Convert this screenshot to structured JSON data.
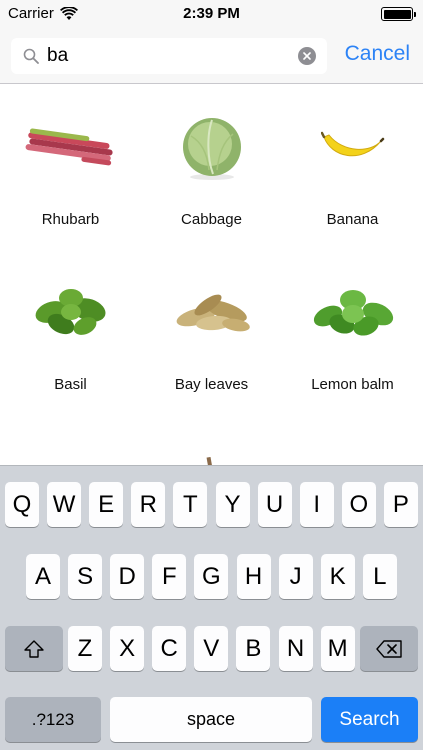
{
  "status_bar": {
    "carrier": "Carrier",
    "time": "2:39 PM"
  },
  "search": {
    "value": "ba",
    "cancel_label": "Cancel"
  },
  "results": [
    {
      "name": "Rhubarb",
      "icon": "rhubarb-image"
    },
    {
      "name": "Cabbage",
      "icon": "cabbage-image"
    },
    {
      "name": "Banana",
      "icon": "banana-image"
    },
    {
      "name": "Basil",
      "icon": "basil-image"
    },
    {
      "name": "Bay leaves",
      "icon": "bay-leaves-image"
    },
    {
      "name": "Lemon balm",
      "icon": "lemon-balm-image"
    }
  ],
  "keyboard": {
    "row1": [
      "Q",
      "W",
      "E",
      "R",
      "T",
      "Y",
      "U",
      "I",
      "O",
      "P"
    ],
    "row2": [
      "A",
      "S",
      "D",
      "F",
      "G",
      "H",
      "J",
      "K",
      "L"
    ],
    "row3": [
      "Z",
      "X",
      "C",
      "V",
      "B",
      "N",
      "M"
    ],
    "numbers_label": ".?123",
    "space_label": "space",
    "search_label": "Search"
  },
  "colors": {
    "accent": "#2c83f6",
    "search_key": "#1b7ff7",
    "keyboard_bg": "#cfd3d9"
  }
}
